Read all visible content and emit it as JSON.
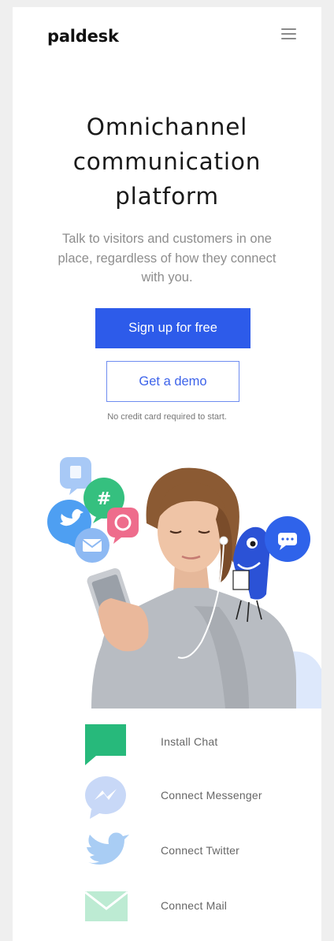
{
  "header": {
    "logo": "paldesk",
    "menu_icon": "hamburger-menu-icon"
  },
  "hero": {
    "title_line1": "Omnichannel",
    "title_line2": "communication",
    "title_line3": "platform",
    "subtitle_line1": "Talk to visitors and customers in one",
    "subtitle_line2": "place, regardless of how they connect",
    "subtitle_line3": "with you.",
    "primary_cta": "Sign up for free",
    "secondary_cta": "Get a demo",
    "note": "No credit card required to start."
  },
  "illustration": {
    "floating_icons": [
      "facebook-icon",
      "hashtag-icon",
      "viber-icon",
      "twitter-icon",
      "mail-icon",
      "chat-bubble-icon"
    ],
    "colors": {
      "facebook": "#9cc3f5",
      "hashtag": "#34c07f",
      "viber": "#ec6a8a",
      "twitter": "#4d9ef0",
      "mail": "#8cb8f2",
      "chat": "#2f63ea",
      "mascot": "#2b52d6"
    }
  },
  "channels": [
    {
      "label": "Install Chat",
      "icon": "chat-icon",
      "color": "#27b97b"
    },
    {
      "label": "Connect Messenger",
      "icon": "messenger-icon",
      "color": "#c8d8f7"
    },
    {
      "label": "Connect Twitter",
      "icon": "twitter-icon",
      "color": "#a9cdf4"
    },
    {
      "label": "Connect Mail",
      "icon": "mail-icon",
      "color": "#bdebd3"
    }
  ],
  "colors": {
    "primary": "#2d5bea",
    "outline": "#6e8cf0",
    "text_muted": "#8d8d8d",
    "page_bg": "#ffffff"
  }
}
